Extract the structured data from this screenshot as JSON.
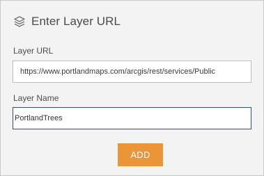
{
  "header": {
    "icon": "layers-icon",
    "title": "Enter Layer URL"
  },
  "fields": {
    "url_label": "Layer URL",
    "url_value": "https://www.portlandmaps.com/arcgis/rest/services/Public",
    "name_label": "Layer Name",
    "name_value": "PortlandTrees"
  },
  "actions": {
    "add_label": "ADD"
  },
  "colors": {
    "accent": "#ea9537",
    "panel_background": "#f3f3f3",
    "focus_border": "#2e4f8f"
  }
}
